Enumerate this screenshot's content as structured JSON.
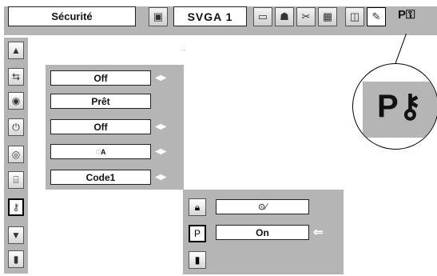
{
  "header": {
    "title": "Sécurité",
    "mode": "SVGA 1",
    "tab_icons": [
      "projector-icon",
      "screen-icon",
      "people-icon",
      "color-balance-icon",
      "image-icon",
      "speaker-icon",
      "pencil-icon"
    ],
    "key_label": "P"
  },
  "sidebar": {
    "items": [
      {
        "icon": "triangle-up-icon"
      },
      {
        "icon": "input-switch-icon"
      },
      {
        "icon": "lamp-icon"
      },
      {
        "icon": "power-icon"
      },
      {
        "icon": "lamp-counter-icon"
      },
      {
        "icon": "filter-icon"
      },
      {
        "icon": "key-icon"
      },
      {
        "icon": "triangle-down-icon"
      },
      {
        "icon": "exit-icon"
      }
    ]
  },
  "panel": {
    "rows": [
      {
        "value": "Off",
        "arrows": "◀▶"
      },
      {
        "value": "Prêt",
        "arrows": ""
      },
      {
        "value": "Off",
        "arrows": "◀▶"
      },
      {
        "value": "A",
        "arrows": "◀▶"
      },
      {
        "value": "Code1",
        "arrows": "◀▶"
      }
    ]
  },
  "submenu": {
    "rows": [
      {
        "icon": "lock-icon",
        "value": ""
      },
      {
        "icon": "pin-code-icon",
        "value": "On"
      },
      {
        "icon": "exit-icon",
        "value": ""
      }
    ],
    "pointer": "⇐"
  },
  "zoom": {
    "label": "P"
  }
}
